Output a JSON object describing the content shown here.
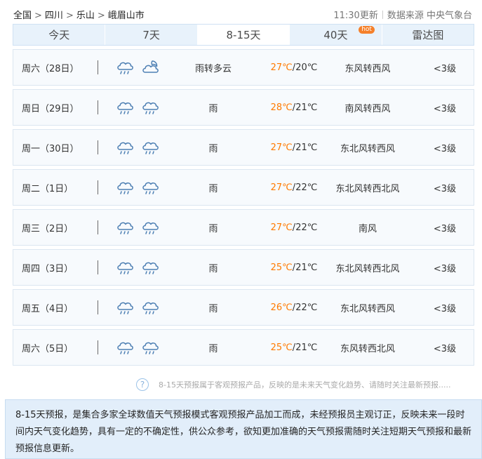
{
  "breadcrumb": {
    "items": [
      "全国",
      "四川",
      "乐山",
      "峨眉山市"
    ],
    "separator": ">"
  },
  "header": {
    "update_time": "11:30更新",
    "source_label": "数据来源",
    "source_name": "中央气象台"
  },
  "tabs": [
    {
      "label": "今天"
    },
    {
      "label": "7天"
    },
    {
      "label": "8-15天",
      "active": true
    },
    {
      "label": "40天",
      "badge": "hot"
    },
    {
      "label": "雷达图"
    }
  ],
  "forecast": [
    {
      "date": "周六（28日）",
      "icon_day": "rain-icon",
      "icon_night": "partly-cloudy-night-icon",
      "weather": "雨转多云",
      "high": "27℃",
      "low": "20℃",
      "wind": "东风转西风",
      "level": "<3级"
    },
    {
      "date": "周日（29日）",
      "icon_day": "rain-icon",
      "icon_night": "rain-icon",
      "weather": "雨",
      "high": "28℃",
      "low": "21℃",
      "wind": "南风转西风",
      "level": "<3级"
    },
    {
      "date": "周一（30日）",
      "icon_day": "rain-icon",
      "icon_night": "rain-icon",
      "weather": "雨",
      "high": "27℃",
      "low": "21℃",
      "wind": "东北风转西风",
      "level": "<3级"
    },
    {
      "date": "周二（1日）",
      "icon_day": "rain-icon",
      "icon_night": "rain-icon",
      "weather": "雨",
      "high": "27℃",
      "low": "22℃",
      "wind": "东北风转西北风",
      "level": "<3级"
    },
    {
      "date": "周三（2日）",
      "icon_day": "rain-icon",
      "icon_night": "rain-icon",
      "weather": "雨",
      "high": "27℃",
      "low": "22℃",
      "wind": "南风",
      "level": "<3级"
    },
    {
      "date": "周四（3日）",
      "icon_day": "rain-icon",
      "icon_night": "rain-icon",
      "weather": "雨",
      "high": "25℃",
      "low": "21℃",
      "wind": "东北风转西北风",
      "level": "<3级"
    },
    {
      "date": "周五（4日）",
      "icon_day": "rain-icon",
      "icon_night": "rain-icon",
      "weather": "雨",
      "high": "26℃",
      "low": "22℃",
      "wind": "东北风转西风",
      "level": "<3级"
    },
    {
      "date": "周六（5日）",
      "icon_day": "rain-icon",
      "icon_night": "rain-icon",
      "weather": "雨",
      "high": "25℃",
      "low": "21℃",
      "wind": "东风转西北风",
      "level": "<3级"
    }
  ],
  "note": {
    "icon": "question-icon",
    "text": "8-15天预报属于客观预报产品，反映的是未来天气变化趋势、请随时关注最新预报....."
  },
  "description": "8-15天预报，是集合多家全球数值天气预报模式客观预报产品加工而成，未经预报员主观订正，反映未来一段时间内天气变化趋势，具有一定的不确定性，供公众参考，欲知更加准确的天气预报需随时关注短期天气预报和最新预报信息更新。",
  "colors": {
    "accent": "#ff7a00",
    "tab_bg": "#e8f2fb",
    "row_bg": "#f7fafd",
    "desc_bg": "#e2eefa",
    "icon_stroke": "#4d7fb3",
    "hot_badge": "#f5802a"
  }
}
